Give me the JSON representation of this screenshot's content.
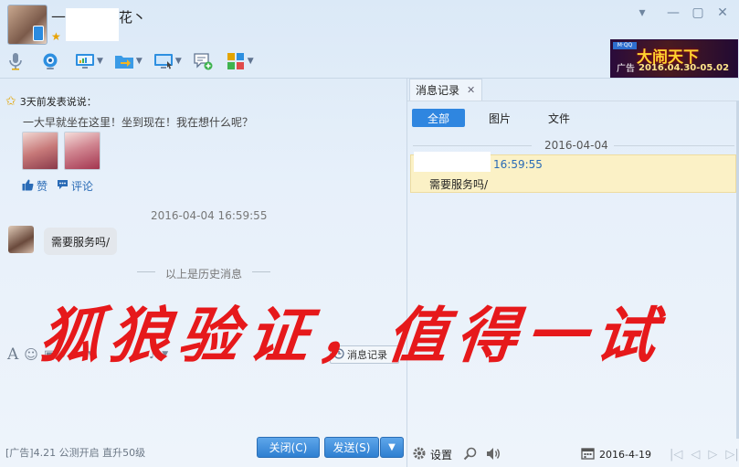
{
  "window": {
    "title_prefix": "—",
    "title_suffix": "花丶",
    "controls": [
      "chevron-down-icon",
      "minimize-icon",
      "maximize-icon",
      "close-icon"
    ]
  },
  "toolbar": {
    "items": [
      {
        "name": "voice-call",
        "icon": "microphone-icon",
        "has_menu": false
      },
      {
        "name": "video-call",
        "icon": "webcam-icon",
        "has_menu": false
      },
      {
        "name": "remote-desktop",
        "icon": "monitor-chart-icon",
        "has_menu": true
      },
      {
        "name": "send-file",
        "icon": "folder-transfer-icon",
        "has_menu": true
      },
      {
        "name": "screen-share",
        "icon": "screen-share-icon",
        "has_menu": true
      },
      {
        "name": "create-group",
        "icon": "chat-add-icon",
        "has_menu": false
      },
      {
        "name": "apps",
        "icon": "app-grid-icon",
        "has_menu": true
      }
    ]
  },
  "ad_banner": {
    "label": "广告",
    "headline": "大闹天下",
    "dates": "2016.04.30-05.02",
    "brand": "M·QQ"
  },
  "feed": {
    "header": "3天前发表说说：",
    "text": "一大早就坐在这里！坐到现在！我在想什么呢？",
    "like": "赞",
    "comment": "评论"
  },
  "chat": {
    "timestamp": "2016-04-04 16:59:55",
    "message": "需要服务吗/",
    "history_divider": "以上是历史消息"
  },
  "input": {
    "msg_record_button": "消息记录"
  },
  "overlay_text": "狐狼验证，值得一试",
  "footer": {
    "ad_text": "[广告]4.21 公测开启 直升50级",
    "close_button": "关闭(C)",
    "send_button": "发送(S)"
  },
  "history_panel": {
    "tab_label": "消息记录",
    "filters": [
      "全部",
      "图片",
      "文件"
    ],
    "date": "2016-04-04",
    "time": "16:59:55",
    "message": "需要服务吗/",
    "settings_label": "设置",
    "current_date": "2016-4-19"
  },
  "colors": {
    "accent": "#2f86e0",
    "overlay_red": "#e6191b",
    "highlight": "#fbf1c6"
  }
}
